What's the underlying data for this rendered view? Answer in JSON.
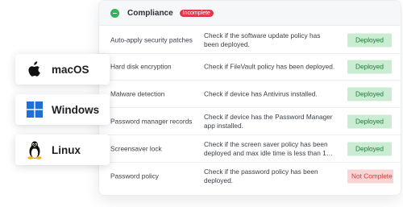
{
  "compliance": {
    "title": "Compliance",
    "status_badge": "Incomplete",
    "rows": [
      {
        "name": "Auto-apply security patches",
        "description": "Check if the software update policy has been deployed.",
        "status": "Deployed"
      },
      {
        "name": "Hard disk encryption",
        "description": "Check if FileVault policy has been deployed.",
        "status": "Deployed"
      },
      {
        "name": "Malware detection",
        "description": "Check if device has Antivirus installed.",
        "status": "Deployed"
      },
      {
        "name": "Password manager records",
        "description": "Check if device has the Password Manager app installed.",
        "status": "Deployed"
      },
      {
        "name": "Screensaver lock",
        "description": "Check if the screen saver policy has been deployed and max idle time is less than 1…",
        "status": "Deployed"
      },
      {
        "name": "Password policy",
        "description": "Check if the password policy has been deployed.",
        "status": "Not Complete"
      }
    ]
  },
  "os_list": [
    {
      "label": "macOS",
      "icon": "apple-icon"
    },
    {
      "label": "Windows",
      "icon": "windows-icon"
    },
    {
      "label": "Linux",
      "icon": "linux-icon"
    }
  ],
  "colors": {
    "deployed_bg": "#c9ecd2",
    "deployed_text": "#1f7a3a",
    "not_complete_bg": "#f8d5d5",
    "not_complete_text": "#d33a3a",
    "incomplete_badge": "#e0394a",
    "status_green": "#2fb45a"
  }
}
